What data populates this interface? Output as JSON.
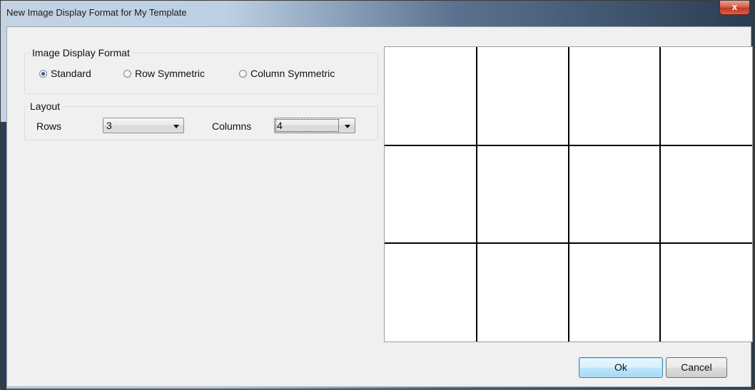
{
  "window": {
    "title": "New Image Display Format for My Template",
    "close_glyph": "x"
  },
  "image_display_format": {
    "legend": "Image Display Format",
    "options": [
      {
        "label": "Standard",
        "checked": true
      },
      {
        "label": "Row Symmetric",
        "checked": false
      },
      {
        "label": "Column Symmetric",
        "checked": false
      }
    ]
  },
  "layout": {
    "legend": "Layout",
    "rows_label": "Rows",
    "rows_value": "3",
    "columns_label": "Columns",
    "columns_value": "4"
  },
  "preview": {
    "rows": 3,
    "columns": 4,
    "line_color": "#000000"
  },
  "buttons": {
    "ok": "Ok",
    "cancel": "Cancel"
  }
}
